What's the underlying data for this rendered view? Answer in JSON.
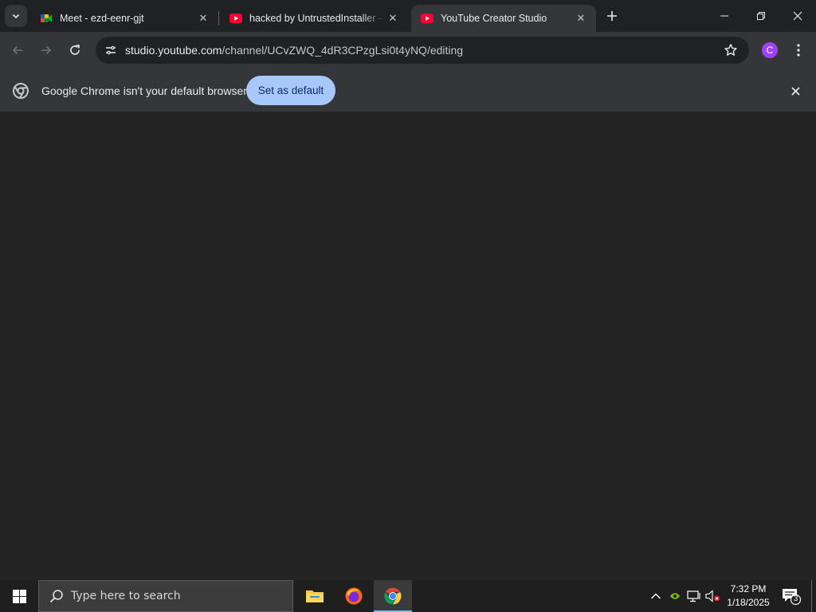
{
  "tabs": [
    {
      "title": "Meet - ezd-eenr-gjt",
      "favicon": "google-meet-icon",
      "active": false
    },
    {
      "title": "hacked by UntrustedInstaller - YouTube",
      "favicon": "youtube-icon",
      "active": false
    },
    {
      "title": "YouTube Creator Studio",
      "favicon": "youtube-icon",
      "active": true
    }
  ],
  "toolbar": {
    "url_host": "studio.youtube.com",
    "url_path": "/channel/UCvZWQ_4dR3CPzgLsi0t4yNQ/editing",
    "profile_initial": "C"
  },
  "infobar": {
    "message": "Google Chrome isn't your default browser",
    "button_label": "Set as default"
  },
  "taskbar": {
    "search_placeholder": "Type here to search",
    "apps": [
      "file-explorer",
      "firefox",
      "chrome"
    ],
    "time": "7:32 PM",
    "date": "1/18/2025",
    "notification_count": "3"
  },
  "colors": {
    "tab_strip": "#202124",
    "toolbar": "#35363a",
    "content": "#242424",
    "accent_button": "#a8c7fa",
    "profile": "#a142f4",
    "youtube_red": "#ff0033"
  }
}
